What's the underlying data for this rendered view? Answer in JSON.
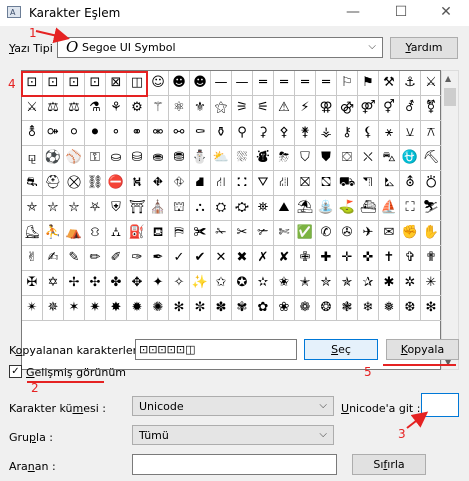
{
  "window": {
    "icon_text": "A",
    "title": "Karakter Eşlem",
    "minimize_glyph": "—",
    "maximize_glyph": "☐",
    "close_glyph": "✕"
  },
  "font_row": {
    "label_underlined": "Y",
    "label_rest": "azı Tipi :",
    "font_o_glyph": "O",
    "selected_font": "Segoe UI Symbol",
    "help_button_underlined": "Y",
    "help_button_rest": "ardım"
  },
  "grid": {
    "rows": [
      [
        "⊡",
        "⊡",
        "⊡",
        "⊡",
        "⊠",
        "◫",
        "☺",
        "☻",
        "☻",
        "—",
        "—",
        "═",
        "═",
        "═",
        "═",
        "⚐",
        "⚑",
        "⚒",
        "⚓",
        "⚔"
      ],
      [
        "⚔",
        "⚖",
        "⚖",
        "⚗",
        "⚘",
        "⚙",
        "⚚",
        "⚛",
        "⚜",
        "⚝",
        "⚞",
        "⚟",
        "⚠",
        "⚡",
        "⚢",
        "⚣",
        "⚤",
        "⚥",
        "⚦",
        "⚧"
      ],
      [
        "⚨",
        "⚩",
        "⚪",
        "⚫",
        "⚬",
        "⚭",
        "⚮",
        "⚯",
        "⚰",
        "⚱",
        "⚲",
        "⚳",
        "⚴",
        "⚵",
        "⚶",
        "⚷",
        "⚸",
        "⚹",
        "⚺",
        "⚻"
      ],
      [
        "⚼",
        "⚽",
        "⚾",
        "⚿",
        "⛀",
        "⛁",
        "⛂",
        "⛃",
        "⛄",
        "⛅",
        "⛆",
        "⛇",
        "⛈",
        "⛉",
        "⛊",
        "⛋",
        "⛌",
        "⛍",
        "⛎",
        "⛏"
      ],
      [
        "⛐",
        "⛑",
        "⛒",
        "⛓",
        "⛔",
        "⛕",
        "⛖",
        "⛗",
        "⛘",
        "⛙",
        "⛚",
        "⛛",
        "⛜",
        "⛝",
        "⛞",
        "⛟",
        "⛠",
        "⛡",
        "⛢",
        "⛣"
      ],
      [
        "⛤",
        "⛥",
        "⛦",
        "⛧",
        "⛨",
        "⛩",
        "⛪",
        "⛫",
        "⛬",
        "⛭",
        "⛮",
        "⛯",
        "⛰",
        "⛱",
        "⛲",
        "⛳",
        "⛴",
        "⛵",
        "⛶",
        "⛷"
      ],
      [
        "⛸",
        "⛹",
        "⛺",
        "⛻",
        "⛼",
        "⛽",
        "⛾",
        "⛿",
        "✀",
        "✁",
        "✂",
        "✃",
        "✄",
        "✅",
        "✆",
        "✇",
        "✈",
        "✉",
        "✊",
        "✋"
      ],
      [
        "✌",
        "✍",
        "✎",
        "✏",
        "✐",
        "✑",
        "✒",
        "✓",
        "✔",
        "✕",
        "✖",
        "✗",
        "✘",
        "✙",
        "✚",
        "✛",
        "✜",
        "✝",
        "✞",
        "✟"
      ],
      [
        "✠",
        "✡",
        "✢",
        "✣",
        "✤",
        "✥",
        "✦",
        "✧",
        "✨",
        "✩",
        "✪",
        "✫",
        "✬",
        "✭",
        "✮",
        "✯",
        "✰",
        "✱",
        "✲",
        "✳"
      ],
      [
        "✴",
        "✵",
        "✶",
        "✷",
        "✸",
        "✹",
        "✺",
        "✻",
        "✼",
        "✽",
        "✾",
        "✿",
        "❀",
        "❁",
        "❂",
        "❃",
        "❄",
        "❅",
        "❆",
        "❇"
      ]
    ],
    "scroll_up_glyph": "▲",
    "scroll_down_glyph": "▼"
  },
  "copy_row": {
    "label_pre": "K",
    "label_underlined": "o",
    "label_rest": "pyalanan karakterler :",
    "value": "⊡⊡⊡⊡⊡◫",
    "select_button_underlined": "S",
    "select_button_rest": "eç",
    "copy_button_underlined": "K",
    "copy_button_rest": "opyala"
  },
  "advanced": {
    "checked": true,
    "check_glyph": "✓",
    "label_underlined": "G",
    "label_rest": "elişmiş görünüm"
  },
  "charset_row": {
    "label_pre": "Karakter kü",
    "label_underlined": "m",
    "label_rest": "esi :",
    "value": "Unicode",
    "goto_label_pre": "",
    "goto_label_underlined": "U",
    "goto_label_rest": "nicode'a git :",
    "goto_value": ""
  },
  "group_row": {
    "label_pre": "Gru",
    "label_underlined": "p",
    "label_rest": "la :",
    "value": "Tümü"
  },
  "search_row": {
    "label_pre": "Ara",
    "label_underlined": "n",
    "label_rest": "an :",
    "value": "",
    "reset_button_pre": "Sı",
    "reset_button_underlined": "f",
    "reset_button_rest": "ırla"
  },
  "annotations": {
    "n1": "1",
    "n2": "2",
    "n3": "3",
    "n4": "4",
    "n5": "5",
    "color": "#e52222"
  }
}
